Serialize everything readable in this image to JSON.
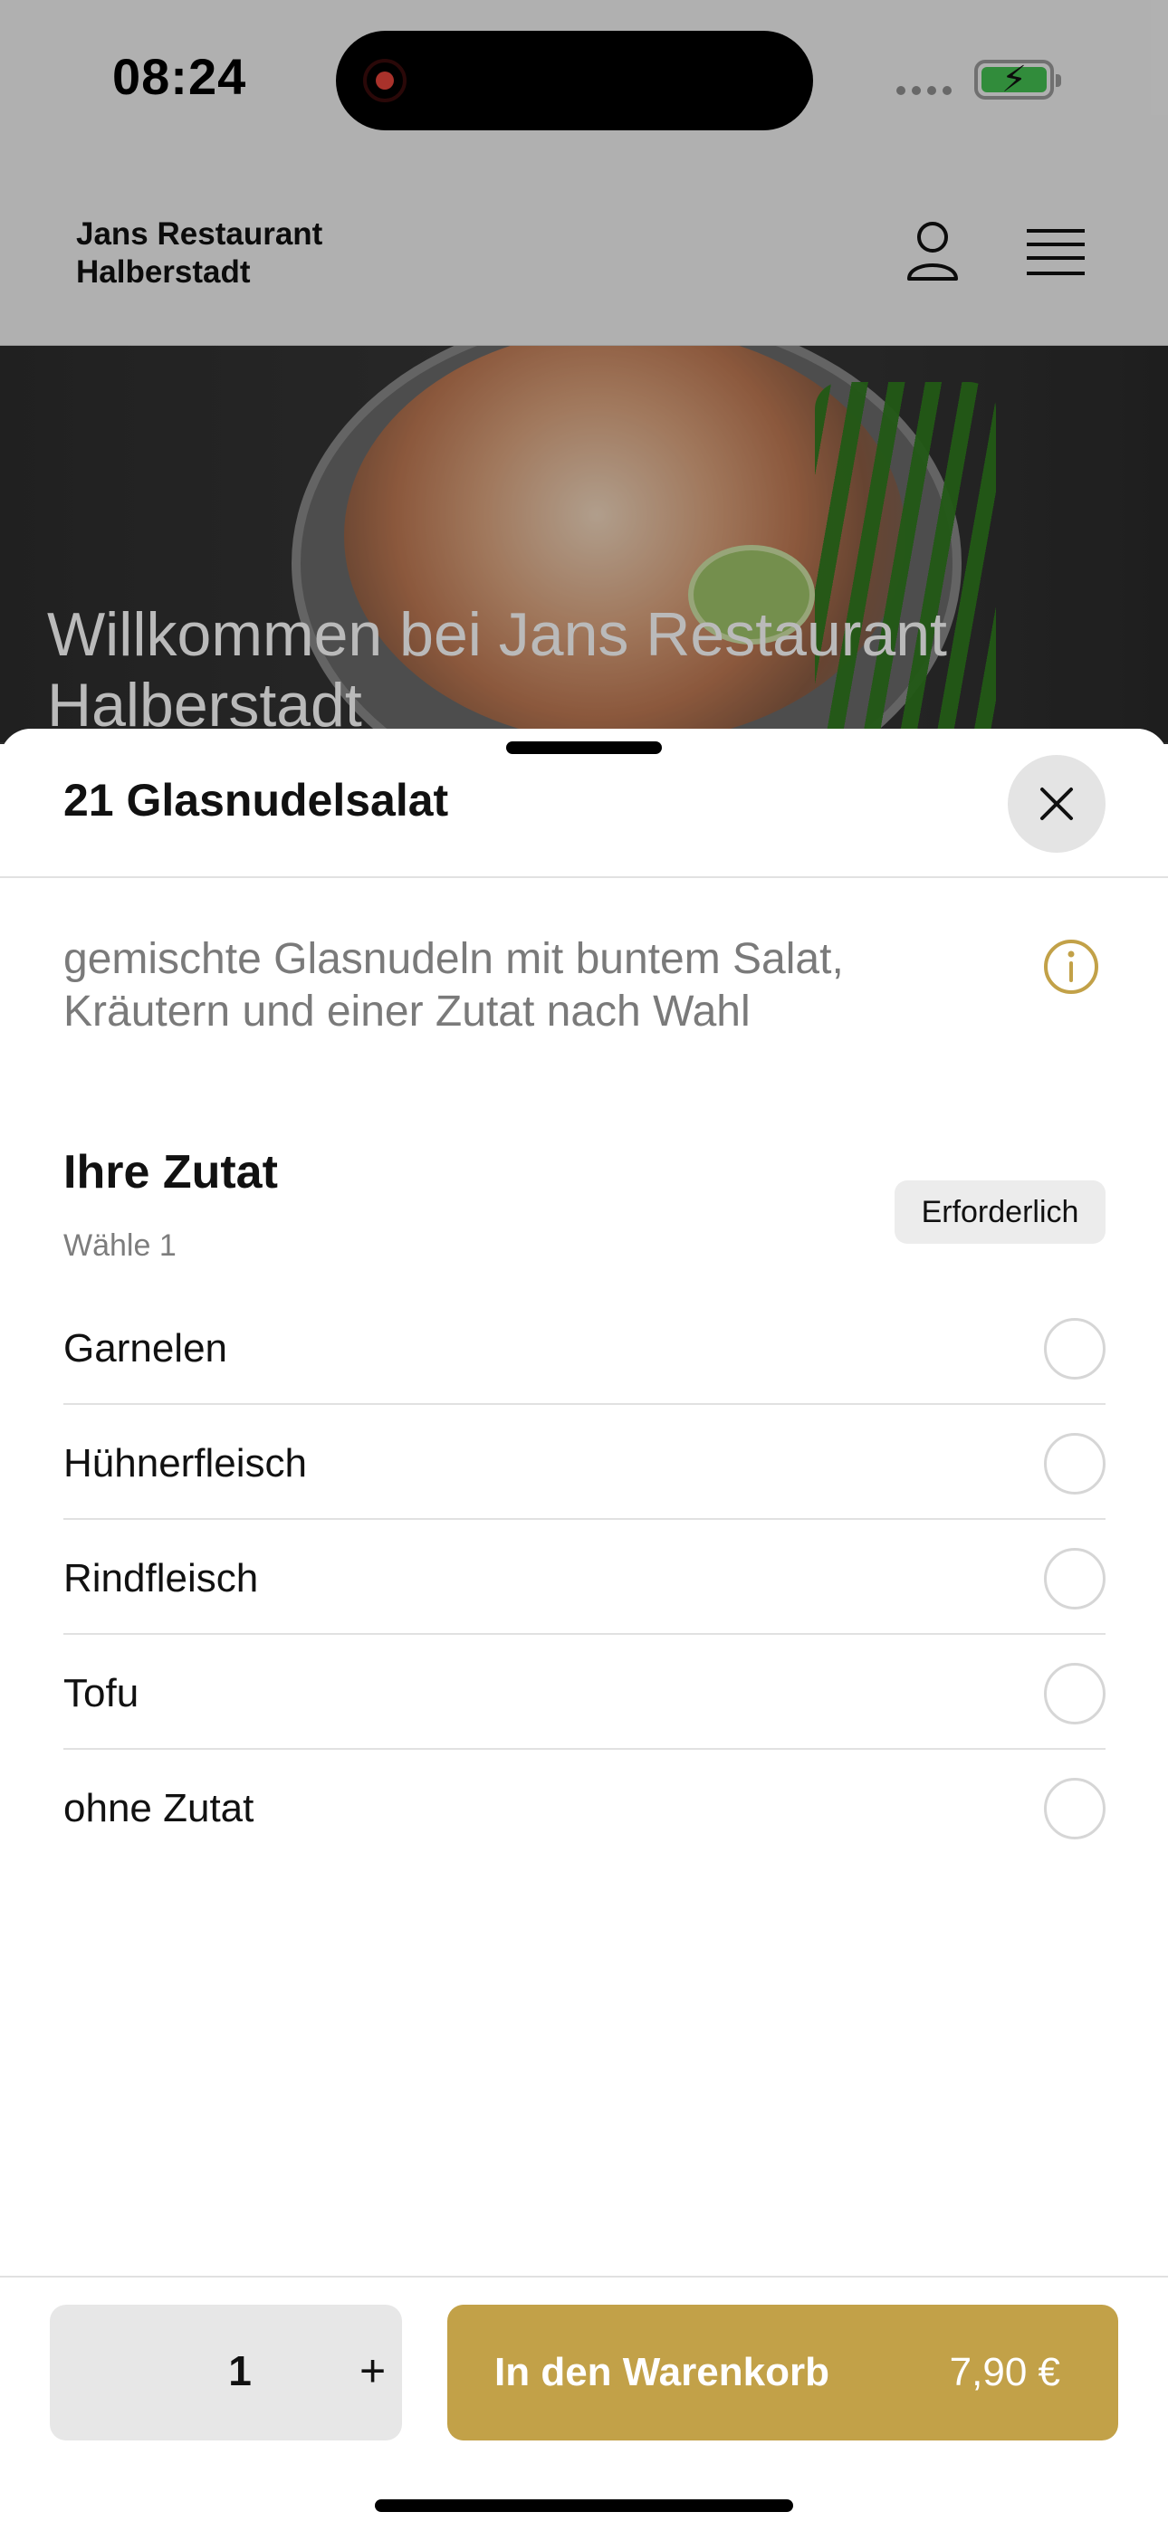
{
  "status_bar": {
    "time": "08:24"
  },
  "header": {
    "brand_line1": "Jans Restaurant",
    "brand_line2": "Halberstadt",
    "icons": [
      "user-icon",
      "menu-icon"
    ]
  },
  "hero": {
    "title": "Willkommen bei Jans Restaurant Halberstadt"
  },
  "sheet": {
    "title": "21 Glasnudelsalat",
    "description": "gemischte Glasnudeln mit buntem Salat, Kräutern und einer Zutat nach Wahl",
    "group": {
      "title": "Ihre Zutat",
      "subtitle": "Wähle 1",
      "badge": "Erforderlich",
      "options": [
        "Garnelen",
        "Hühnerfleisch",
        "Rindfleisch",
        "Tofu",
        "ohne Zutat"
      ]
    }
  },
  "footer": {
    "quantity": "1",
    "plus": "+",
    "cart_label": "In den Warenkorb",
    "price": "7,90 €"
  },
  "colors": {
    "accent": "#c2a148",
    "info": "#c2a148",
    "overlay": "rgba(0,0,0,0.27)"
  }
}
